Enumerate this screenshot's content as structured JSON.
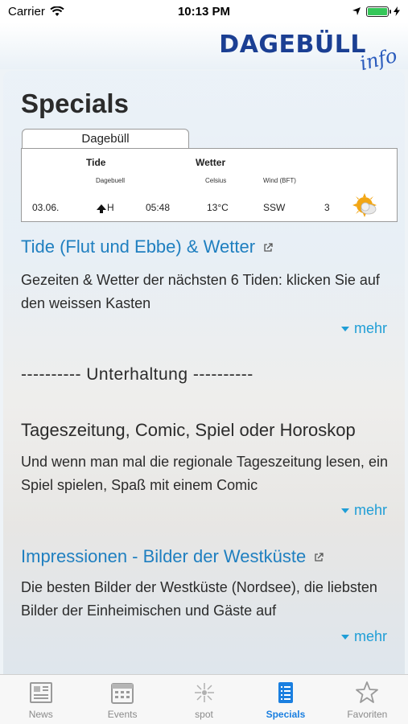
{
  "status_bar": {
    "carrier": "Carrier",
    "time": "10:13 PM"
  },
  "header": {
    "logo_main": "DAGEBÜLL",
    "logo_sub": "info"
  },
  "page": {
    "title": "Specials"
  },
  "tide_widget": {
    "tab_label": "Dagebüll",
    "headers": {
      "tide": "Tide",
      "weather": "Wetter",
      "location": "Dagebuell",
      "celsius": "Celsius",
      "wind": "Wind (BFT)"
    },
    "row": {
      "date": "03.06.",
      "tide": "H",
      "time": "05:48",
      "temp": "13°C",
      "wind_dir": "SSW",
      "wind_force": "3"
    },
    "weather_icon": "partly-cloudy-icon"
  },
  "sections": [
    {
      "title": "Tide (Flut und Ebbe) & Wetter",
      "link": true,
      "text": "Gezeiten & Wetter der nächsten 6 Tiden: klicken Sie auf den weissen Kasten",
      "more": "mehr"
    },
    {
      "divider": "---------- Unterhaltung ----------"
    },
    {
      "title": "Tageszeitung, Comic, Spiel oder Horoskop",
      "link": false,
      "text": "Und wenn man mal die regionale Tageszeitung lesen, ein Spiel spielen, Spaß mit einem Comic",
      "more": "mehr"
    },
    {
      "title": "Impressionen - Bilder der Westküste",
      "link": true,
      "text": "Die besten Bilder der Westküste (Nordsee), die liebsten Bilder der Einheimischen und Gäste auf",
      "more": "mehr"
    }
  ],
  "tabs": [
    {
      "label": "News",
      "icon": "newspaper-icon",
      "active": false
    },
    {
      "label": "Events",
      "icon": "calendar-icon",
      "active": false
    },
    {
      "label": "spot",
      "icon": "spot-icon",
      "active": false
    },
    {
      "label": "Specials",
      "icon": "list-icon",
      "active": true
    },
    {
      "label": "Favoriten",
      "icon": "star-icon",
      "active": false
    }
  ],
  "colors": {
    "accent": "#1a7fe0",
    "link": "#1f7fc0",
    "logo": "#1b3f93"
  }
}
